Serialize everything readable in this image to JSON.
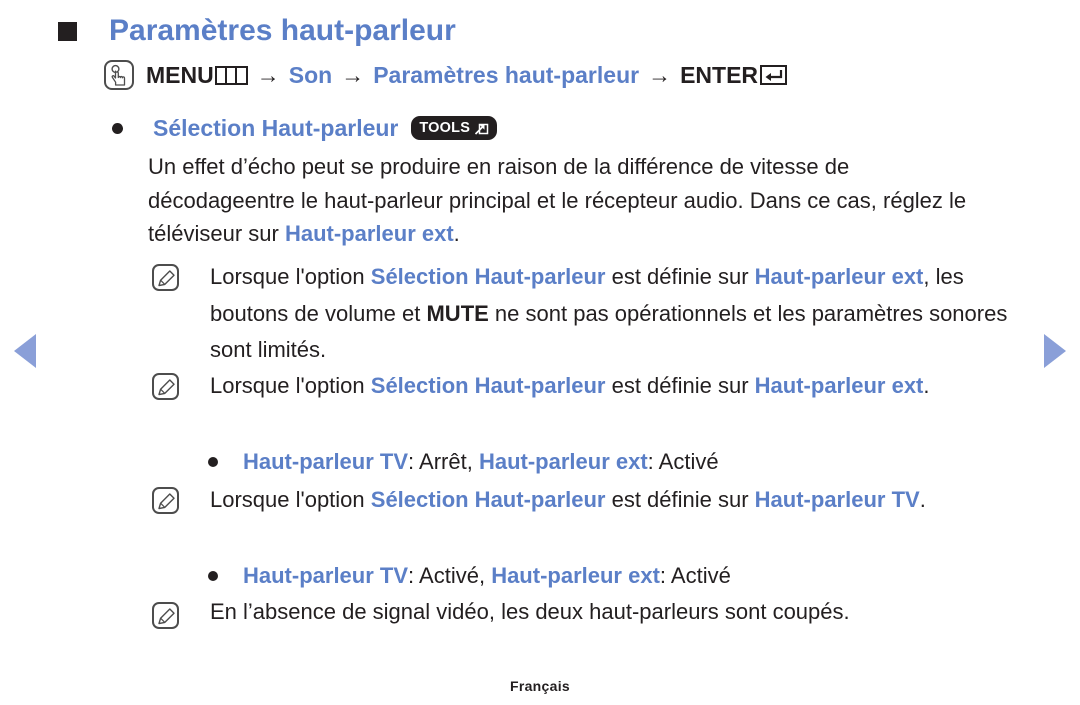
{
  "page": {
    "title": "Paramètres haut-parleur",
    "footer_language": "Français"
  },
  "nav": {
    "prev_label": "◀",
    "next_label": "▶"
  },
  "menu_path": {
    "hand_icon": "hand-touch-icon",
    "menu_label": "MENU",
    "menu_glyph": "menu-bars-icon",
    "arrow1": "→",
    "son_label": "Son",
    "arrow2": "→",
    "settings_label": "Paramètres haut-parleur",
    "arrow3": "→",
    "enter_label": "ENTER",
    "enter_glyph": "enter-return-icon"
  },
  "section": {
    "bullet": "dot-bullet",
    "label": "Sélection Haut-parleur",
    "tools_badge": {
      "text": "TOOLS",
      "icon": "tools-arrow-icon"
    }
  },
  "paragraph": {
    "part1": "Un effet d’écho peut se produire en raison de la différence de vitesse de décodageentre le haut-parleur principal et le récepteur audio. Dans ce cas, réglez le téléviseur sur ",
    "highlight": "Haut-parleur ext",
    "part2": "."
  },
  "notes": [
    {
      "icon": "note-pencil-icon",
      "p1": "Lorsque l'option ",
      "blue1": "Sélection Haut-parleur",
      "p2": " est définie sur ",
      "blue2": "Haut-parleur ext",
      "p3": ", les boutons de volume et ",
      "bold1": "MUTE",
      "p4": " ne sont pas opérationnels et les paramètres sonores sont limités."
    },
    {
      "icon": "note-pencil-icon",
      "p1": "Lorsque l'option ",
      "blue1": "Sélection Haut-parleur",
      "p2": " est définie sur ",
      "blue2": "Haut-parleur ext",
      "p3": ".",
      "bold1": "",
      "p4": ""
    },
    {
      "icon": "note-pencil-icon",
      "p1": "Lorsque l'option ",
      "blue1": "Sélection Haut-parleur",
      "p2": " est définie sur ",
      "blue2": "Haut-parleur TV",
      "p3": ".",
      "bold1": "",
      "p4": ""
    },
    {
      "icon": "note-pencil-icon",
      "p1": "En l’absence de signal vidéo, les deux haut-parleurs sont coupés.",
      "blue1": "",
      "p2": "",
      "blue2": "",
      "p3": "",
      "bold1": "",
      "p4": ""
    }
  ],
  "sub_bullets": [
    {
      "blue1": "Haut-parleur TV",
      "mid1": ": Arrêt, ",
      "blue2": "Haut-parleur ext",
      "mid2": ": Activé"
    },
    {
      "blue1": "Haut-parleur TV",
      "mid1": ": Activé, ",
      "blue2": "Haut-parleur ext",
      "mid2": ": Activé"
    }
  ],
  "colors": {
    "accent_blue": "#5b7fc7",
    "arrow_blue": "#8a9fd8",
    "text_black": "#231f20"
  }
}
